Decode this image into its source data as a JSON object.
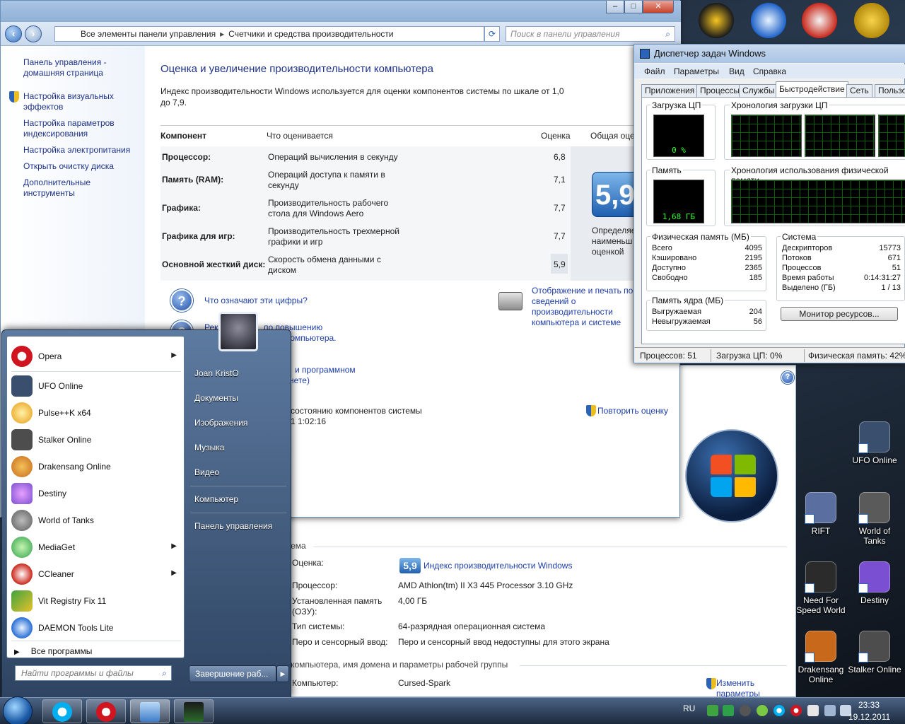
{
  "control_panel": {
    "address_segments": [
      "Все элементы панели управления",
      "Счетчики и средства производительности"
    ],
    "search_placeholder": "Поиск в панели управления",
    "sidebar": [
      "Панель управления - домашняя страница",
      "Настройка визуальных эффектов",
      "Настройка параметров индексирования",
      "Настройка электропитания",
      "Открыть очистку диска",
      "Дополнительные инструменты"
    ],
    "heading": "Оценка и увеличение производительности компьютера",
    "description": "Индекс производительности Windows используется для оценки компонентов системы по шкале от 1,0 до 7,9.",
    "table_headers": {
      "component": "Компонент",
      "what": "Что оценивается",
      "score": "Оценка",
      "overall": "Общая оце"
    },
    "rows": [
      {
        "component": "Процессор:",
        "what": "Операций вычисления в секунду",
        "score": "6,8"
      },
      {
        "component": "Память (RAM):",
        "what": "Операций доступа к памяти в секунду",
        "score": "7,1"
      },
      {
        "component": "Графика:",
        "what": "Производительность рабочего стола для Windows Aero",
        "score": "7,7"
      },
      {
        "component": "Графика для игр:",
        "what": "Производительность трехмерной графики и игр",
        "score": "7,7"
      },
      {
        "component": "Основной жесткий диск:",
        "what": "Скорость обмена данными с диском",
        "score": "5,9"
      }
    ],
    "base_score": "5,9",
    "badge_caption": "Определяе наименьш оценкой",
    "link_what_numbers": "Что означают эти цифры?",
    "link_print": "Отображение и печать по сведений о производительности компьютера и системе",
    "link_tips_a": "Реко",
    "link_tips_b": "по повышению",
    "link_tips_c": "компьютера.",
    "link_software_a": "и программном",
    "link_software_b": "нете)",
    "state_text": "состоянию компонентов системы",
    "state_time": "1 1:02:16",
    "retry_link": "Повторить оценку"
  },
  "system_window": {
    "section_system": "истема",
    "rating_label": "Оценка:",
    "rating_badge": "5,9",
    "rating_link": "Индекс производительности Windows",
    "processor_label": "Процессор:",
    "processor_value": "AMD Athlon(tm) II X3 445 Processor   3.10 GHz",
    "ram_label": "Установленная память (ОЗУ):",
    "ram_value": "4,00 ГБ",
    "type_label": "Тип системы:",
    "type_value": "64-разрядная операционная система",
    "pen_label": "Перо и сенсорный ввод:",
    "pen_value": "Перо и сенсорный ввод недоступны для этого экрана",
    "section_name": "мя компьютера, имя домена и параметры рабочей группы",
    "computer_label": "Компьютер:",
    "computer_value": "Cursed-Spark",
    "change_link": "Изменить параметры"
  },
  "task_manager": {
    "title": "Диспетчер задач Windows",
    "menu": [
      "Файл",
      "Параметры",
      "Вид",
      "Справка"
    ],
    "tabs": [
      "Приложения",
      "Процессы",
      "Службы",
      "Быстродействие",
      "Сеть",
      "Пользо"
    ],
    "active_tab": 3,
    "cpu_label": "Загрузка ЦП",
    "cpu_value": "0 %",
    "cpu_history_label": "Хронология загрузки ЦП",
    "mem_label": "Память",
    "mem_value": "1,68 ГБ",
    "mem_history_label": "Хронология использования физической памяти",
    "physical_title": "Физическая память (МБ)",
    "physical": [
      {
        "label": "Всего",
        "value": "4095"
      },
      {
        "label": "Кэшировано",
        "value": "2195"
      },
      {
        "label": "Доступно",
        "value": "2365"
      },
      {
        "label": "Свободно",
        "value": "185"
      }
    ],
    "kernel_title": "Память ядра (МБ)",
    "kernel": [
      {
        "label": "Выгружаемая",
        "value": "204"
      },
      {
        "label": "Невыгружаемая",
        "value": "56"
      }
    ],
    "system_title": "Система",
    "system": [
      {
        "label": "Дескрипторов",
        "value": "15773"
      },
      {
        "label": "Потоков",
        "value": "671"
      },
      {
        "label": "Процессов",
        "value": "51"
      },
      {
        "label": "Время работы",
        "value": "0:14:31:27"
      },
      {
        "label": "Выделено (ГБ)",
        "value": "1 / 13"
      }
    ],
    "resource_button": "Монитор ресурсов...",
    "status_processes": "Процессов: 51",
    "status_cpu": "Загрузка ЦП: 0%",
    "status_memory": "Физическая память: 42%"
  },
  "start_menu": {
    "programs": [
      {
        "label": "Opera",
        "icon": "opera-icon",
        "submenu": true,
        "color": "#d01420"
      },
      {
        "label": "UFO Online",
        "icon": "ufo-online-icon",
        "submenu": false,
        "color": "#3a4f6e"
      },
      {
        "label": "Pulse++K x64",
        "icon": "pulse-icon",
        "submenu": false,
        "color": "#e89a12"
      },
      {
        "label": "Stalker Online",
        "icon": "stalker-online-icon",
        "submenu": false,
        "color": "#4d4d4d"
      },
      {
        "label": "Drakensang Online",
        "icon": "drakensang-icon",
        "submenu": false,
        "color": "#c8681b"
      },
      {
        "label": "Destiny",
        "icon": "destiny-icon",
        "submenu": false,
        "color": "#7a4fd1"
      },
      {
        "label": "World of Tanks",
        "icon": "world-of-tanks-icon",
        "submenu": false,
        "color": "#5a5a5a"
      },
      {
        "label": "MediaGet",
        "icon": "mediaget-icon",
        "submenu": true,
        "color": "#2fa04a"
      },
      {
        "label": "CCleaner",
        "icon": "ccleaner-icon",
        "submenu": true,
        "color": "#cc2a1f"
      },
      {
        "label": "Vit Registry Fix 11",
        "icon": "registry-fix-icon",
        "submenu": false,
        "color": "#3fa33f"
      },
      {
        "label": "DAEMON Tools Lite",
        "icon": "daemon-tools-icon",
        "submenu": false,
        "color": "#2a6fd6"
      }
    ],
    "all_programs": "Все программы",
    "search_placeholder": "Найти программы и файлы",
    "right_items": [
      "Joan KristO",
      "Документы",
      "Изображения",
      "Музыка",
      "Видео",
      "Компьютер",
      "Панель управления"
    ],
    "shutdown": "Завершение раб..."
  },
  "desktop_icons": [
    {
      "label": "UFO Online",
      "color": "#3a4f6e"
    },
    {
      "label": "RIFT",
      "color": "#5a6fa0"
    },
    {
      "label": "World of Tanks",
      "color": "#5a5a5a"
    },
    {
      "label": "Need For Speed World",
      "color": "#2b2b2b"
    },
    {
      "label": "Destiny",
      "color": "#7a4fd1"
    },
    {
      "label": "Drakensang Online",
      "color": "#c8681b"
    },
    {
      "label": "Stalker Online",
      "color": "#4d4d4d"
    }
  ],
  "taskbar": {
    "lang": "RU",
    "time": "23:33",
    "date": "19.12.2011"
  }
}
